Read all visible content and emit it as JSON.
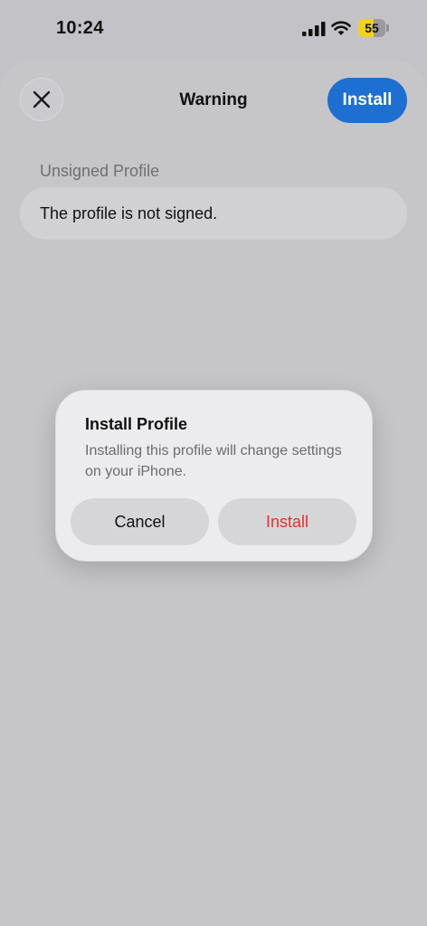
{
  "status_bar": {
    "time": "10:24",
    "battery_level": "55",
    "battery_fraction": 0.55,
    "battery_color": "#f4d21a"
  },
  "sheet": {
    "title": "Warning",
    "install_label": "Install",
    "close_icon": "close-icon",
    "accent_color": "#1d6fd2"
  },
  "section": {
    "header": "Unsigned Profile",
    "cell_text": "The profile is not signed."
  },
  "alert": {
    "title": "Install Profile",
    "message": "Installing this profile will change settings on your iPhone.",
    "cancel_label": "Cancel",
    "install_label": "Install",
    "destructive_color": "#e0322e"
  }
}
